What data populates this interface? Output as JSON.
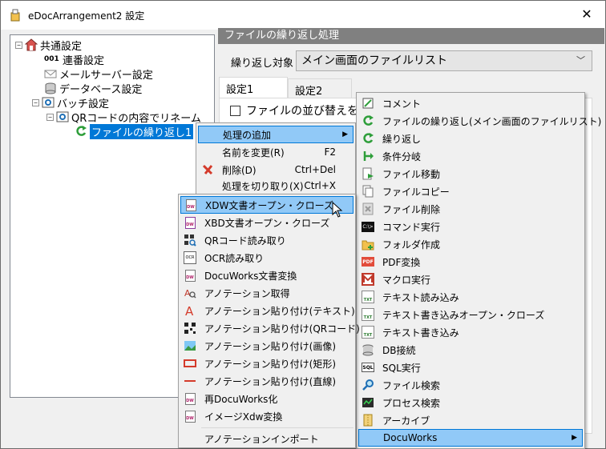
{
  "window": {
    "title": "eDocArrangement2 設定",
    "close_glyph": "✕"
  },
  "tree": {
    "expander_minus": "−",
    "items": [
      {
        "label": "共通設定"
      },
      {
        "label": "連番設定",
        "icon_text": "001"
      },
      {
        "label": "メールサーバー設定"
      },
      {
        "label": "データベース設定"
      },
      {
        "label": "バッチ設定"
      },
      {
        "label": "QRコードの内容でリネーム"
      },
      {
        "label": "ファイルの繰り返し1"
      }
    ]
  },
  "panel": {
    "header": "ファイルの繰り返し処理",
    "target_label": "繰り返し対象",
    "target_value": "メイン画面のファイルリスト",
    "tabs": [
      "設定1",
      "設定2"
    ],
    "checkbox_label": "ファイルの並び替えを行"
  },
  "context_menu": {
    "items": [
      {
        "label": "処理の追加",
        "shortcut": "",
        "arrow": "▶"
      },
      {
        "label": "名前を変更(R)",
        "shortcut": "F2"
      },
      {
        "label": "削除(D)",
        "shortcut": "Ctrl+Del"
      },
      {
        "label": "処理を切り取り(X)",
        "shortcut": "Ctrl+X"
      }
    ]
  },
  "add_menu": {
    "items": [
      {
        "label": "コメント"
      },
      {
        "label": "ファイルの繰り返し(メイン画面のファイルリスト)"
      },
      {
        "label": "繰り返し"
      },
      {
        "label": "条件分岐"
      },
      {
        "label": "ファイル移動"
      },
      {
        "label": "ファイルコピー"
      },
      {
        "label": "ファイル削除"
      },
      {
        "label": "コマンド実行"
      },
      {
        "label": "フォルダ作成"
      },
      {
        "label": "PDF変換"
      },
      {
        "label": "マクロ実行"
      },
      {
        "label": "テキスト読み込み"
      },
      {
        "label": "テキスト書き込みオープン・クローズ"
      },
      {
        "label": "テキスト書き込み"
      },
      {
        "label": "DB接続"
      },
      {
        "label": "SQL実行"
      },
      {
        "label": "ファイル検索"
      },
      {
        "label": "プロセス検索"
      },
      {
        "label": "アーカイブ"
      },
      {
        "label": "DocuWorks",
        "arrow": "▶"
      }
    ]
  },
  "docuworks_menu": {
    "items": [
      {
        "label": "XDW文書オープン・クローズ"
      },
      {
        "label": "XBD文書オープン・クローズ"
      },
      {
        "label": "QRコード読み取り"
      },
      {
        "label": "OCR読み取り"
      },
      {
        "label": "DocuWorks文書変換"
      },
      {
        "label": "アノテーション取得"
      },
      {
        "label": "アノテーション貼り付け(テキスト)"
      },
      {
        "label": "アノテーション貼り付け(QRコード)"
      },
      {
        "label": "アノテーション貼り付け(画像)"
      },
      {
        "label": "アノテーション貼り付け(矩形)"
      },
      {
        "label": "アノテーション貼り付け(直線)"
      },
      {
        "label": "再DocuWorks化"
      },
      {
        "label": "イメージXdw変換"
      },
      {
        "label": "アノテーションインポート"
      }
    ]
  },
  "icon_texts": {
    "pdf": "PDF",
    "sql": "SQL",
    "txt": "TXT",
    "dw": "DW",
    "cmd": "C:\\>",
    "ocr": "OCR"
  },
  "colors": {
    "selection": "#0078d7",
    "menu_highlight": "#91c9f7",
    "header_bg": "#808080"
  }
}
